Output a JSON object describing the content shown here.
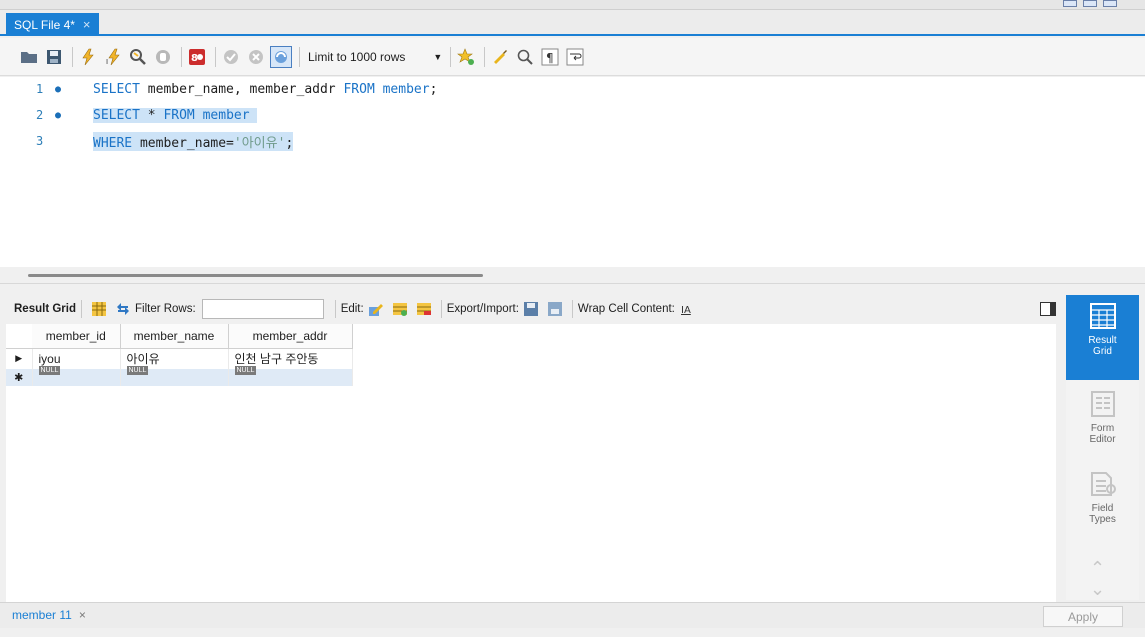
{
  "tabs": {
    "active_label": "SQL File 4*",
    "close_symbol": "×"
  },
  "toolbar": {
    "limit_label": "Limit to 1000 rows",
    "limit_caret": "▼"
  },
  "editor": {
    "lines": [
      {
        "number": "1",
        "dot": "●"
      },
      {
        "number": "2",
        "dot": "●"
      },
      {
        "number": "3",
        "dot": ""
      }
    ]
  },
  "results_toolbar": {
    "result_grid_label": "Result Grid",
    "filter_rows_label": "Filter Rows:",
    "filter_value": "",
    "edit_label": "Edit:",
    "export_import_label": "Export/Import:",
    "wrap_label": "Wrap Cell Content:"
  },
  "grid": {
    "columns": [
      "member_id",
      "member_name",
      "member_addr"
    ],
    "rows": [
      [
        "iyou",
        "아이유",
        "인천 남구 주안동"
      ]
    ],
    "null_label": "NULL"
  },
  "side_panel": {
    "result_grid": "Result Grid",
    "form_editor": "Form Editor",
    "field_types": "Field Types"
  },
  "bottom": {
    "result_tab_label": "member 11",
    "close_symbol": "×",
    "apply_label": "Apply"
  },
  "colors": {
    "accent": "#1a7fd4",
    "keyword": "#1a73c7",
    "selection": "#cde3f7"
  }
}
